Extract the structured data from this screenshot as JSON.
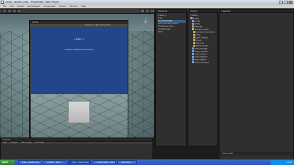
{
  "window": {
    "title": "Unity - level5.unity - PlanetTest - Web Player"
  },
  "menu": [
    "File",
    "Edit",
    "Assets",
    "GameObject",
    "Component",
    "Terrain",
    "Window",
    "Help"
  ],
  "toolbar": {
    "layers_label": "Layers",
    "layout_label": "Layout"
  },
  "game_view": {
    "tab": "Game",
    "tools": "Maximize on Play  Gizmos  Stats",
    "level_text": "LEVEL 1",
    "message_text": "Push the CUBE to red thinhead."
  },
  "hierarchy": {
    "title": "Hierarchy",
    "items": [
      "Create ▾",
      "Cube",
      "Directional light",
      "Floor Bounding Object",
      "First Person Cont...",
      "LevelManager",
      "Plane"
    ]
  },
  "project": {
    "title": "Project",
    "items": [
      "Create ▾",
      "Assets",
      "Level1",
      "Level2",
      "Materials",
      "Standard Assets",
      "Character Controllers",
      "Fonts",
      "Light Cookies",
      "Scripts",
      "Skyboxes",
      "Terrain Assets",
      "level_manager",
      "level_controller",
      "cube_collision",
      "level_selection",
      "level_rotation",
      "level_controller2"
    ]
  },
  "inspector": {
    "title": "Inspector",
    "footer": "Asset Labels"
  },
  "console": {
    "title": "Console",
    "buttons": [
      "Clear",
      "Collapse",
      "Clear on Play",
      "Error Pause"
    ]
  },
  "taskbar": {
    "start": "start",
    "tasks": [
      "Unity - level5.unity...",
      "Untitled - Paint",
      "Unity - level5.unity",
      "Untitled Paint - Paint",
      "Recording..."
    ],
    "clock": "10:53"
  }
}
